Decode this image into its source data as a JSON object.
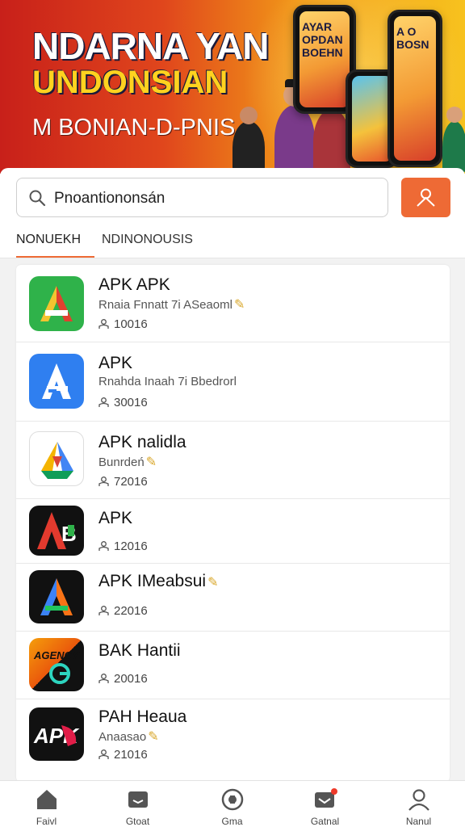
{
  "banner": {
    "title": "NDARNA YAN",
    "subtitle": "UNDONSIAN",
    "tagline": "M BONIAN-D-PNIS",
    "phone_left_text": "AYAR OPDAN BOEHN",
    "phone_right_text": "A O BOSN"
  },
  "search": {
    "value": "Pnoantiononsán"
  },
  "tabs": [
    {
      "label": "NONUEKH",
      "active": true
    },
    {
      "label": "NDINONOUSIS",
      "active": false
    }
  ],
  "apps": [
    {
      "title": "APK APK",
      "desc": "Rnaia Fnnatt 7i ASeaoml",
      "count": "10016",
      "icon": "green-a-icon"
    },
    {
      "title": "APK",
      "desc": "Rnahda Inaah 7i Bbedrorl",
      "count": "30016",
      "icon": "blue-a-icon"
    },
    {
      "title": "APK nalidla",
      "desc": "Bunrdeń",
      "count": "72016",
      "icon": "colorful-a-icon"
    },
    {
      "title": "APK",
      "desc": "",
      "count": "12016",
      "icon": "black-ab-icon"
    },
    {
      "title": "APK IMeabsui",
      "desc": "",
      "count": "22016",
      "icon": "black-a-triangle-icon"
    },
    {
      "title": "BAK Hantii",
      "desc": "",
      "count": "20016",
      "icon": "agency-icon"
    },
    {
      "title": "PAH Heaua",
      "desc": "Anaasao",
      "count": "21016",
      "icon": "apk-logo-icon"
    }
  ],
  "nav": [
    {
      "label": "Faivl",
      "icon": "home-icon"
    },
    {
      "label": "Gtoat",
      "icon": "mail-box-icon"
    },
    {
      "label": "Gma",
      "icon": "compass-icon"
    },
    {
      "label": "Gatnal",
      "icon": "inbox-icon"
    },
    {
      "label": "Nanul",
      "icon": "profile-icon"
    }
  ],
  "colors": {
    "accent": "#ee6a35",
    "banner_red": "#c8201a",
    "banner_yellow": "#f7c21e"
  }
}
